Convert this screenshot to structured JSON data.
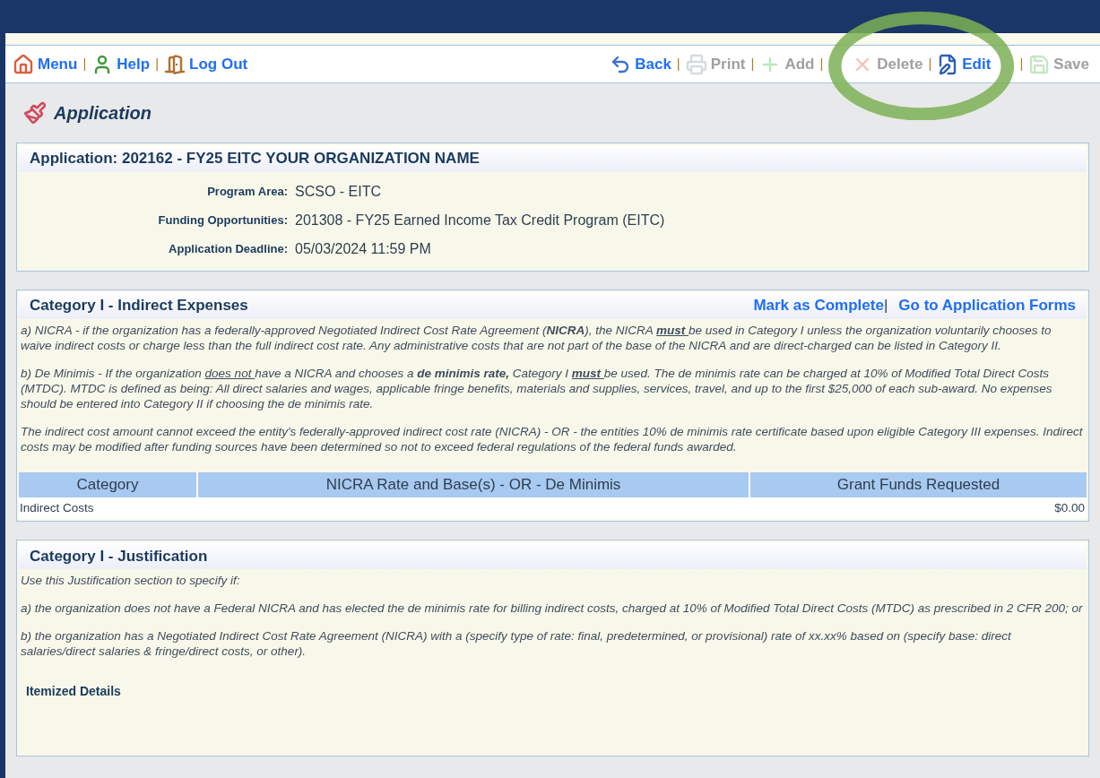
{
  "toolbar": {
    "separator": "|",
    "left": [
      {
        "kind": "menu",
        "label": "Menu",
        "disabled": false
      },
      {
        "kind": "help",
        "label": "Help",
        "disabled": false
      },
      {
        "kind": "logout",
        "label": "Log Out",
        "disabled": false
      }
    ],
    "right": [
      {
        "kind": "back",
        "label": "Back",
        "disabled": false
      },
      {
        "kind": "print",
        "label": "Print",
        "disabled": true
      },
      {
        "kind": "add",
        "label": "Add",
        "disabled": true
      },
      {
        "kind": "delete",
        "label": "Delete",
        "disabled": true,
        "highlighted": true
      },
      {
        "kind": "edit",
        "label": "Edit",
        "disabled": false,
        "highlighted": true
      },
      {
        "kind": "save",
        "label": "Save",
        "disabled": true
      }
    ]
  },
  "page_title": "Application",
  "application_panel": {
    "title": "Application: 202162 - FY25 EITC YOUR ORGANIZATION NAME",
    "fields": [
      {
        "label": "Program Area:",
        "value": "SCSO - EITC"
      },
      {
        "label": "Funding Opportunities:",
        "value": "201308 - FY25 Earned Income Tax Credit Program (EITC)"
      },
      {
        "label": "Application Deadline:",
        "value": "05/03/2024 11:59 PM"
      }
    ]
  },
  "indirect_expenses": {
    "title": "Category I - Indirect Expenses",
    "separator": "|",
    "links": [
      "Mark as Complete",
      "Go to Application Forms"
    ],
    "paragraphs": [
      [
        {
          "kind": "plain",
          "text": "a) NICRA - if the organization has a federally-approved Negotiated Indirect Cost Rate Agreement ("
        },
        {
          "kind": "bold",
          "text": "NICRA"
        },
        {
          "kind": "plain",
          "text": "), the NICRA "
        },
        {
          "kind": "bold_underline",
          "text": "must "
        },
        {
          "kind": "plain",
          "text": "be used in Category I unless the organization voluntarily chooses to waive indirect costs or charge less than the full indirect cost rate. Any administrative costs that are not part of the base of the NICRA and are direct-charged can be listed in Category II."
        }
      ],
      [
        {
          "kind": "plain",
          "text": "b) De Minimis - If the organization "
        },
        {
          "kind": "underline",
          "text": "does not "
        },
        {
          "kind": "plain",
          "text": "have a NICRA and chooses a "
        },
        {
          "kind": "bold",
          "text": "de minimis rate,"
        },
        {
          "kind": "plain",
          "text": " Category I "
        },
        {
          "kind": "bold_underline",
          "text": "must "
        },
        {
          "kind": "plain",
          "text": "be used. The de minimis rate can be charged at 10% of Modified Total Direct Costs (MTDC). MTDC is defined as being: All direct salaries and wages, applicable fringe benefits, materials and supplies, services, travel, and up to the first $25,000 of each sub-award. No expenses should be entered into Category II if choosing the de minimis rate."
        }
      ],
      [
        {
          "kind": "plain",
          "text": "The indirect cost amount cannot exceed the entity's federally-approved indirect cost rate (NICRA) - OR - the entities 10% de minimis rate certificate based upon eligible Category III expenses. Indirect costs may be modified after funding sources have been determined so not to exceed federal regulations of the federal funds awarded."
        }
      ]
    ],
    "table": {
      "columns": [
        "Category",
        "NICRA Rate and Base(s) - OR - De Minimis",
        "Grant Funds Requested"
      ],
      "rows": [
        {
          "category": "Indirect Costs",
          "amount": "$0.00"
        }
      ]
    }
  },
  "justification": {
    "title": "Category I - Justification",
    "paragraphs": [
      "Use this Justification section to specify if:",
      "a) the organization does not have a Federal NICRA and has elected the de minimis rate for billing indirect costs, charged at 10% of Modified Total Direct Costs (MTDC) as prescribed in 2 CFR 200; or",
      "b) the organization has a Negotiated Indirect Cost Rate Agreement (NICRA) with a (specify type of rate: final, predetermined, or provisional) rate of xx.xx% based on (specify base: direct salaries/direct salaries & fringe/direct costs, or other)."
    ],
    "itemized_label": "Itemized Details"
  }
}
